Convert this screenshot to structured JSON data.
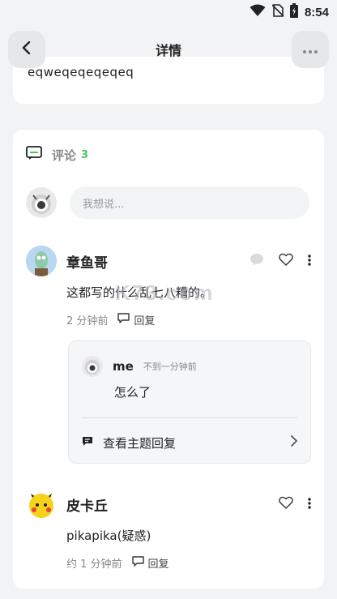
{
  "status_bar": {
    "time": "8:54"
  },
  "header": {
    "title": "详情"
  },
  "post": {
    "text_fragment": "eqweqeqeqeqeq"
  },
  "comments_section": {
    "label": "评论",
    "count": "3",
    "compose_placeholder": "我想说..."
  },
  "comments": [
    {
      "author": "章鱼哥",
      "text": "这都写的什么乱七八糟的。",
      "time": "2 分钟前",
      "reply_label": "回复",
      "replies": [
        {
          "author": "me",
          "time": "不到一分钟前",
          "text": "怎么了"
        }
      ],
      "view_thread_label": "查看主题回复"
    },
    {
      "author": "皮卡丘",
      "text": "pikapika(疑惑)",
      "time": "约 1 分钟前",
      "reply_label": "回复"
    }
  ],
  "watermark": "K73.com",
  "colors": {
    "accent_green": "#4cc764",
    "card_bg": "#ffffff",
    "page_bg": "#f2f3f5"
  }
}
